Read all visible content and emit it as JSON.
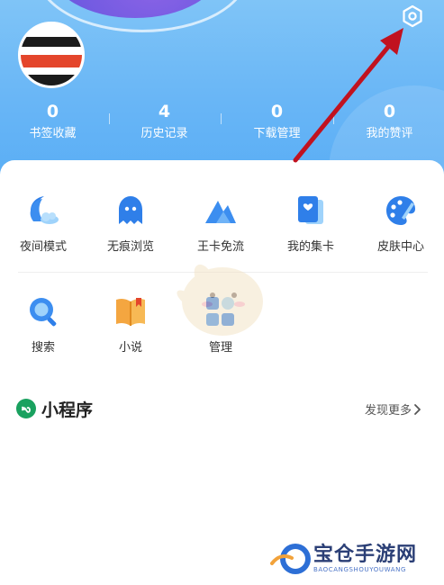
{
  "stats": [
    {
      "value": "0",
      "label": "书签收藏"
    },
    {
      "value": "4",
      "label": "历史记录"
    },
    {
      "value": "0",
      "label": "下载管理"
    },
    {
      "value": "0",
      "label": "我的赞评"
    }
  ],
  "features_row1": [
    {
      "label": "夜间模式",
      "icon": "night-mode-icon"
    },
    {
      "label": "无痕浏览",
      "icon": "incognito-icon"
    },
    {
      "label": "王卡免流",
      "icon": "king-card-icon"
    },
    {
      "label": "我的集卡",
      "icon": "card-collection-icon"
    },
    {
      "label": "皮肤中心",
      "icon": "skin-center-icon"
    }
  ],
  "features_row2": [
    {
      "label": "搜索",
      "icon": "search-icon"
    },
    {
      "label": "小说",
      "icon": "novel-icon"
    },
    {
      "label": "管理",
      "icon": "manage-icon"
    }
  ],
  "mini_programs": {
    "title": "小程序",
    "more": "发现更多"
  },
  "watermark": {
    "text": "宝仓手游网",
    "sub": "BAOCANGSHOUYOUWANG"
  },
  "colors": {
    "header": "#69b6f6",
    "accent_blue": "#3c8ef0",
    "arrow": "#c1121f"
  }
}
